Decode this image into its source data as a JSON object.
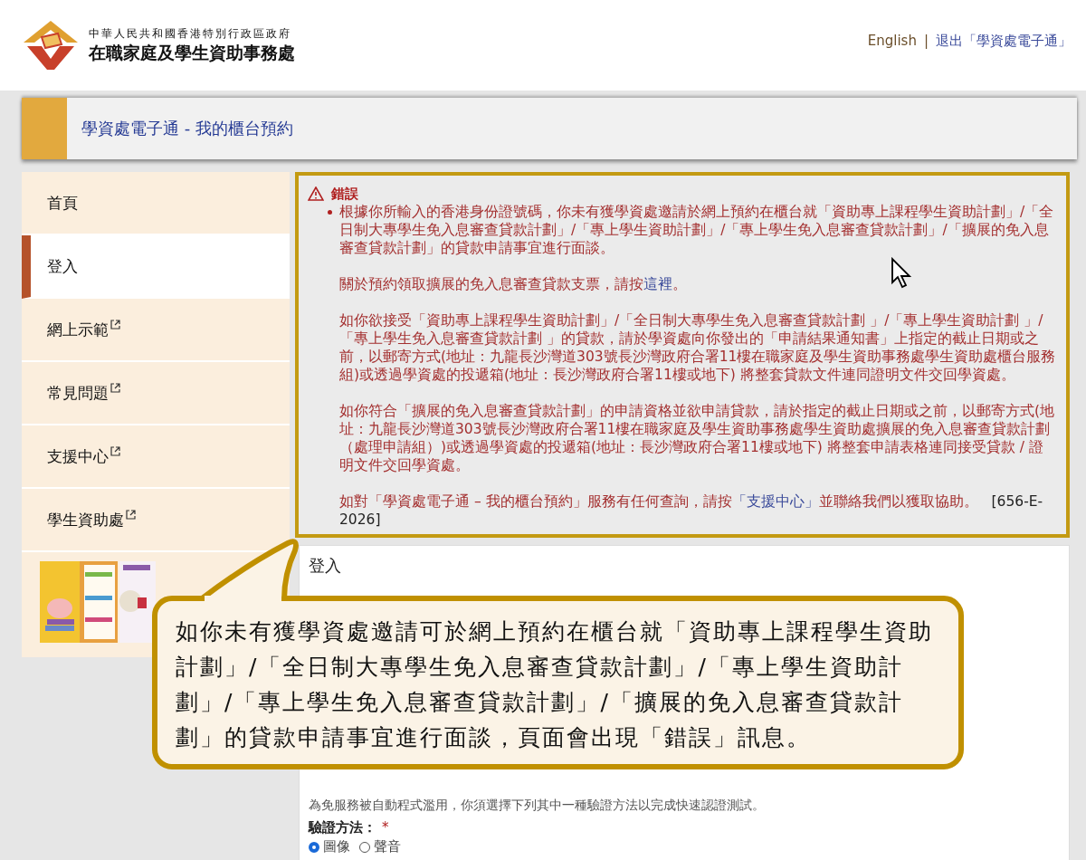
{
  "header": {
    "org_line1": "中華人民共和國香港特別行政區政府",
    "org_line2": "在職家庭及學生資助事務處",
    "links": [
      {
        "label": "English",
        "kind": "plain"
      },
      {
        "label": "退出「學資處電子通」",
        "kind": "link"
      }
    ],
    "separator": "|"
  },
  "page_title": "學資處電子通 - 我的櫃台預約",
  "sidebar": {
    "items": [
      {
        "label": "首頁",
        "selected": false,
        "external": false
      },
      {
        "label": "登入",
        "selected": true,
        "external": false
      },
      {
        "label": "網上示範",
        "selected": false,
        "external": true
      },
      {
        "label": "常見問題",
        "selected": false,
        "external": true
      },
      {
        "label": "支援中心",
        "selected": false,
        "external": true
      },
      {
        "label": "學生資助處",
        "selected": false,
        "external": true
      }
    ]
  },
  "error": {
    "title": "錯誤",
    "paragraphs": [
      [
        {
          "kind": "text",
          "text": "根據你所輸入的香港身份證號碼，你未有獲學資處邀請於網上預約在櫃台就「資助專上課程學生資助計劃」/「全日制大專學生免入息審查貸款計劃」/「專上學生資助計劃」/「專上學生免入息審查貸款計劃」/「擴展的免入息審查貸款計劃」的貸款申請事宜進行面談。"
        }
      ],
      [
        {
          "kind": "text",
          "text": "關於預約領取擴展的免入息審查貸款支票，請按"
        },
        {
          "kind": "link",
          "text": "這裡"
        },
        {
          "kind": "text",
          "text": "。"
        }
      ],
      [
        {
          "kind": "text",
          "text": "如你欲接受「資助專上課程學生資助計劃」/「全日制大專學生免入息審查貸款計劃 」/「專上學生資助計劃 」/「專上學生免入息審查貸款計劃 」的貸款，請於學資處向你發出的「申請結果通知書」上指定的截止日期或之前，以郵寄方式(地址：九龍長沙灣道303號長沙灣政府合署11樓在職家庭及學生資助事務處學生資助處櫃台服務組)或透過學資處的投遞箱(地址：長沙灣政府合署11樓或地下) 將整套貸款文件連同證明文件交回學資處。"
        }
      ],
      [
        {
          "kind": "text",
          "text": "如你符合「擴展的免入息審查貸款計劃」的申請資格並欲申請貸款，請於指定的截止日期或之前，以郵寄方式(地址：九龍長沙灣道303號長沙灣政府合署11樓在職家庭及學生資助事務處學生資助處擴展的免入息審查貸款計劃（處理申請組）)或透過學資處的投遞箱(地址：長沙灣政府合署11樓或地下) 將整套申請表格連同接受貸款 / 證明文件交回學資處。"
        }
      ],
      [
        {
          "kind": "text",
          "text": "如對「學資處電子通 – 我的櫃台預約」服務有任何查詢，請按"
        },
        {
          "kind": "link",
          "text": "「支援中心」"
        },
        {
          "kind": "text",
          "text": "並聯絡我們以獲取協助。 "
        },
        {
          "kind": "code",
          "text": "[656-E-2026]"
        }
      ]
    ]
  },
  "login": {
    "title": "登入",
    "note": "為免服務被自動程式濫用，你須選擇下列其中一種驗證方法以完成快速認證測試。",
    "method_label": "驗證方法：",
    "required_mark": "*",
    "options": [
      {
        "label": "圖像",
        "selected": true
      },
      {
        "label": "聲音",
        "selected": false
      }
    ]
  },
  "callout": {
    "text": "如你未有獲學資處邀請可於網上預約在櫃台就「資助專上課程學生資助計劃」/「全日制大專學生免入息審查貸款計劃」/「專上學生資助計劃」/「專上學生免入息審查貸款計劃」/「擴展的免入息審查貸款計劃」的貸款申請事宜進行面談，頁面會出現「錯誤」訊息。"
  }
}
